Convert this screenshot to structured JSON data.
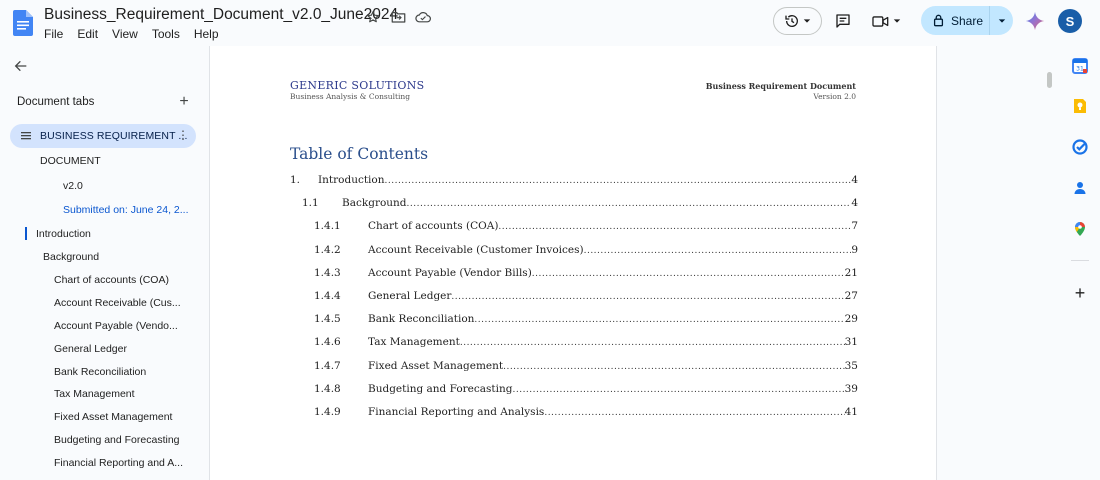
{
  "app": {
    "doc_title": "Business_Requirement_Document_v2.0_June2024",
    "menu": [
      "File",
      "Edit",
      "View",
      "Tools",
      "Help"
    ],
    "share_label": "Share",
    "avatar_initial": "S"
  },
  "sidebar": {
    "heading": "Document tabs",
    "add_symbol": "+",
    "active_tab": "BUSINESS REQUIREMENT ...",
    "more_symbol": "⋮",
    "outline": [
      {
        "label": "DOCUMENT",
        "style": "normal"
      },
      {
        "label": "v2.0",
        "style": "normal"
      },
      {
        "label": "Submitted on: June 24, 2...",
        "style": "blue"
      },
      {
        "label": "Introduction",
        "style": "normal"
      },
      {
        "label": "Background",
        "style": "normal"
      },
      {
        "label": "Chart of accounts (COA)",
        "style": "normal"
      },
      {
        "label": "Account Receivable (Cus...",
        "style": "normal"
      },
      {
        "label": "Account Payable (Vendo...",
        "style": "normal"
      },
      {
        "label": "General Ledger",
        "style": "normal"
      },
      {
        "label": "Bank Reconciliation",
        "style": "normal"
      },
      {
        "label": "Tax Management",
        "style": "normal"
      },
      {
        "label": "Fixed Asset Management",
        "style": "normal"
      },
      {
        "label": "Budgeting and Forecasting",
        "style": "normal"
      },
      {
        "label": "Financial Reporting and A...",
        "style": "normal"
      }
    ]
  },
  "document": {
    "header_left_title": "GENERIC SOLUTIONS",
    "header_left_subtitle": "Business Analysis & Consulting",
    "header_right_title": "Business Requirement Document",
    "header_right_version": "Version 2.0",
    "toc_title": "Table of Contents",
    "toc": [
      {
        "num": "1.",
        "label": "Introduction",
        "page": "4",
        "level": 0
      },
      {
        "num": "1.1",
        "label": "Background",
        "page": "4",
        "level": 1
      },
      {
        "num": "1.4.1",
        "label": "Chart of accounts (COA)",
        "page": "7",
        "level": 2
      },
      {
        "num": "1.4.2",
        "label": "Account Receivable (Customer Invoices)",
        "page": "9",
        "level": 2
      },
      {
        "num": "1.4.3",
        "label": "Account Payable (Vendor Bills)",
        "page": "21",
        "level": 2
      },
      {
        "num": "1.4.4",
        "label": "General Ledger",
        "page": "27",
        "level": 2
      },
      {
        "num": "1.4.5",
        "label": "Bank Reconciliation",
        "page": "29",
        "level": 2
      },
      {
        "num": "1.4.6",
        "label": "Tax Management",
        "page": "31",
        "level": 2
      },
      {
        "num": "1.4.7",
        "label": "Fixed Asset Management",
        "page": "35",
        "level": 2
      },
      {
        "num": "1.4.8",
        "label": "Budgeting and Forecasting",
        "page": "39",
        "level": 2
      },
      {
        "num": "1.4.9",
        "label": "Financial Reporting and Analysis",
        "page": "41",
        "level": 2
      }
    ]
  },
  "icons": {
    "title_bar": [
      "star-icon",
      "move-folder-icon",
      "cloud-saved-icon"
    ],
    "right_panel": [
      "calendar-icon",
      "keep-icon",
      "tasks-icon",
      "contacts-icon",
      "maps-icon"
    ]
  },
  "colors": {
    "share_bg": "#c2e7ff",
    "active_tab_bg": "#d3e3fd",
    "accent_blue": "#0b57d0",
    "toc_heading": "#2b4f8c",
    "avatar_bg": "#1a5ea8"
  }
}
